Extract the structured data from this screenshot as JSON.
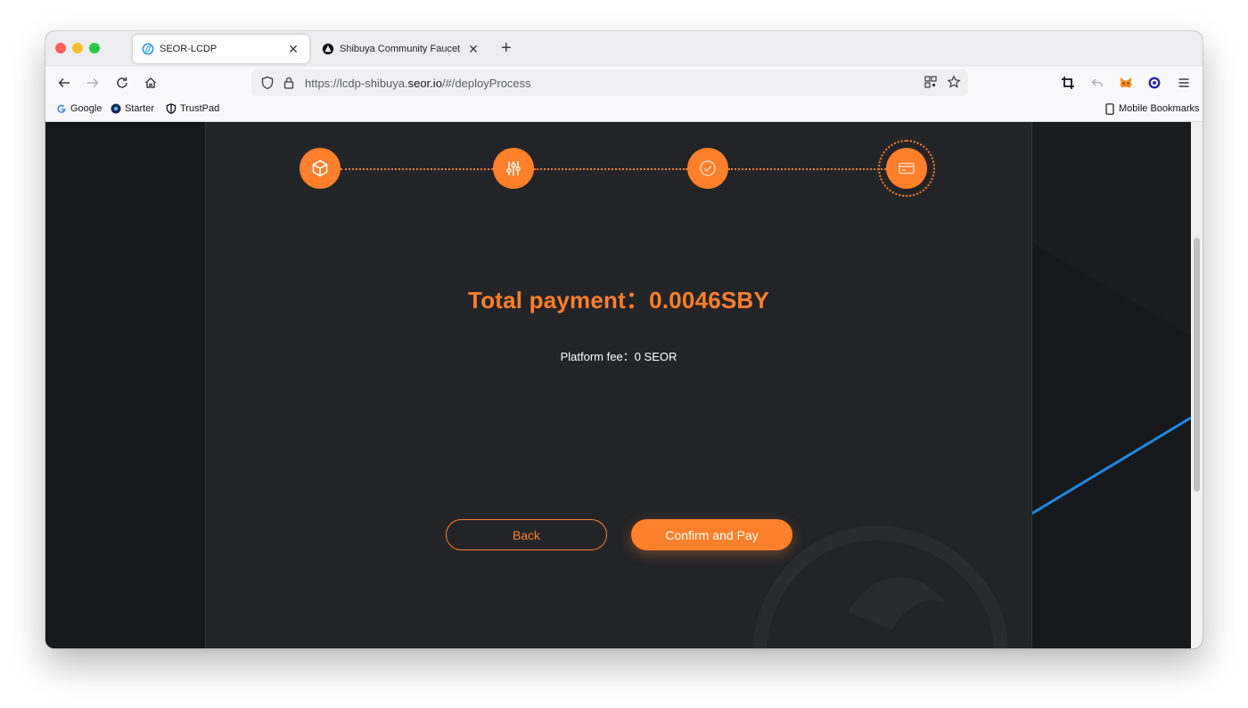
{
  "browser": {
    "tabs": [
      {
        "title": "SEOR-LCDP",
        "active": true
      },
      {
        "title": "Shibuya Community Faucet",
        "active": false
      }
    ],
    "url": {
      "prefix": "https://lcdp-shibuya.",
      "host": "seor.io",
      "suffix": "/#/deployProcess"
    },
    "bookmarks": [
      {
        "label": "Google",
        "icon": "google-icon"
      },
      {
        "label": "Starter",
        "icon": "starter-icon"
      },
      {
        "label": "TrustPad",
        "icon": "trustpad-icon"
      }
    ],
    "mobile_bookmarks": "Mobile Bookmarks"
  },
  "page": {
    "steps": [
      {
        "icon": "cube-icon",
        "state": "done"
      },
      {
        "icon": "sliders-icon",
        "state": "done"
      },
      {
        "icon": "check-circle-icon",
        "state": "done"
      },
      {
        "icon": "card-icon",
        "state": "current"
      }
    ],
    "total_payment": "Total payment：0.0046SBY",
    "platform_fee": "Platform fee：0 SEOR",
    "back_label": "Back",
    "confirm_label": "Confirm and Pay"
  },
  "colors": {
    "accent": "#ff7f2a",
    "panel": "#232428",
    "background": "#17181b",
    "line_blue": "#1e88e5"
  }
}
